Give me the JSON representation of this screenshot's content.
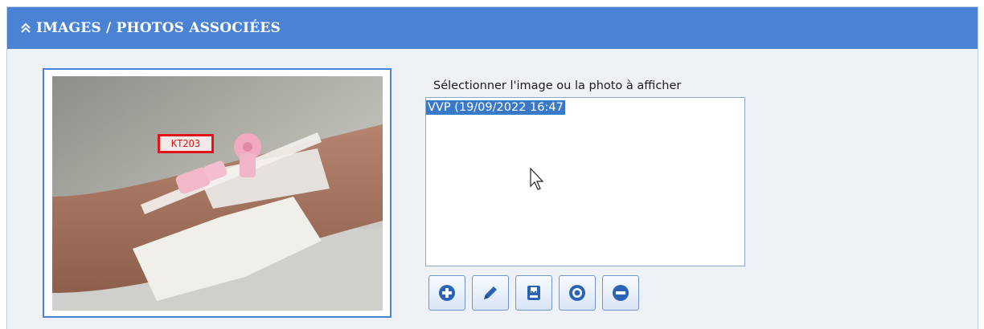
{
  "section": {
    "title": "IMAGES / PHOTOS ASSOCIÉES",
    "collapse_icon": "chevron-double-up-icon"
  },
  "photo": {
    "label_tag": "KT2O3"
  },
  "image_list": {
    "label": "Sélectionner l'image ou la photo à afficher",
    "items": [
      {
        "text": "VVP (19/09/2022 16:47",
        "selected": true
      }
    ]
  },
  "toolbar": {
    "buttons": [
      {
        "icon": "add-circle-icon"
      },
      {
        "icon": "pencil-icon"
      },
      {
        "icon": "download-tray-icon"
      },
      {
        "icon": "target-icon"
      },
      {
        "icon": "remove-circle-icon"
      }
    ]
  },
  "colors": {
    "header_bg": "#4b83d4",
    "accent": "#2c64b5",
    "selection": "#3a79c8",
    "tag_border": "#e2141b"
  }
}
